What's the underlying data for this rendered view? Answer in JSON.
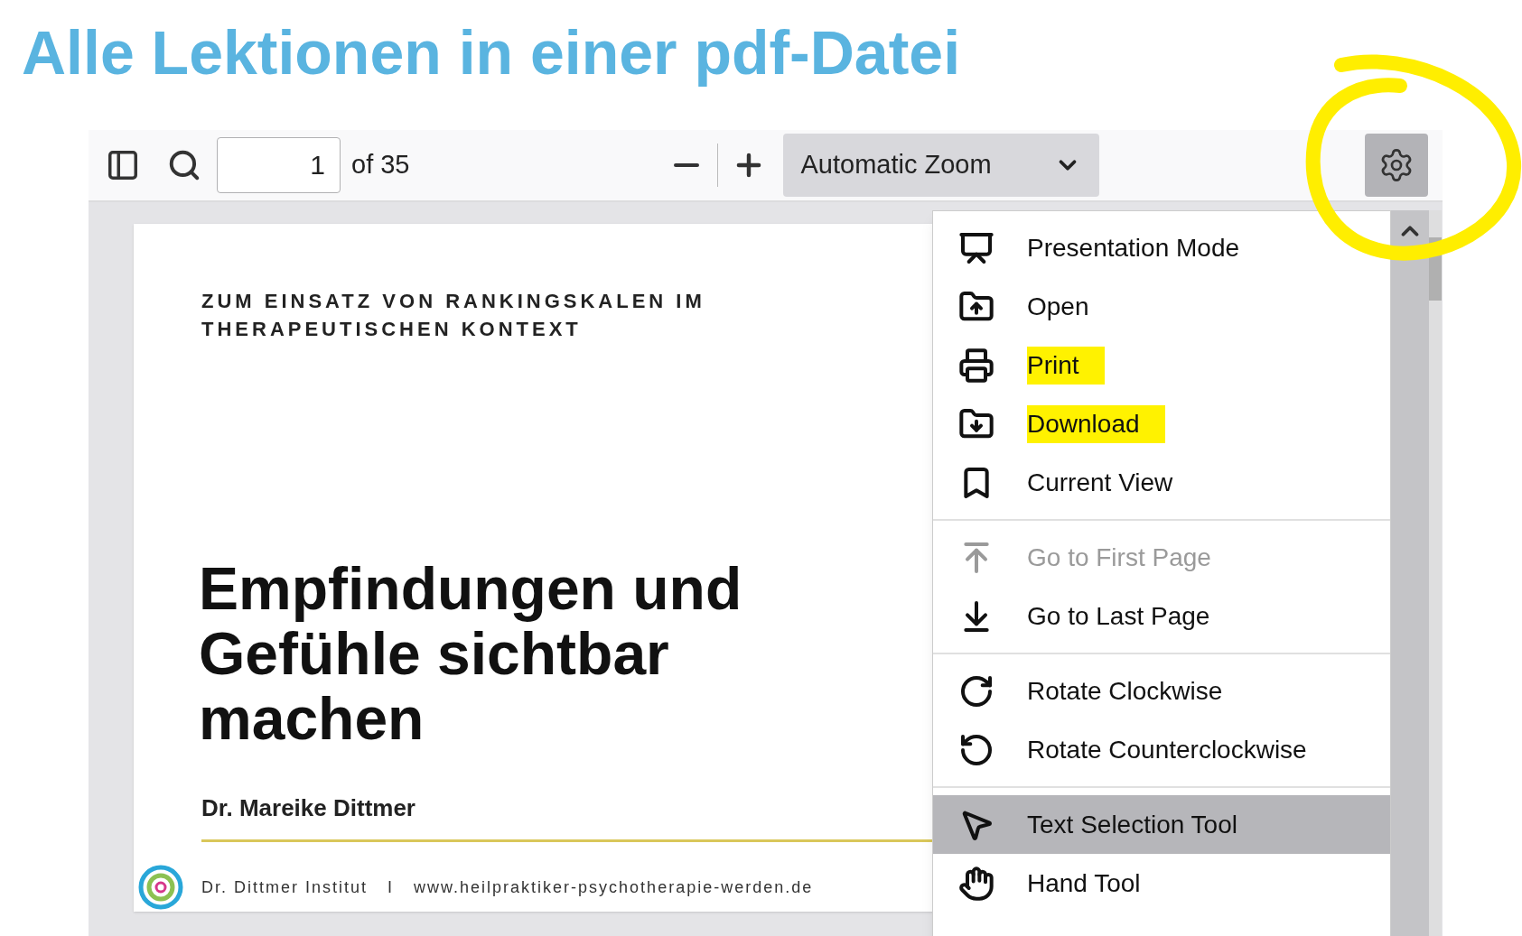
{
  "heading": "Alle Lektionen in einer pdf-Datei",
  "toolbar": {
    "page_number": "1",
    "page_count": "of 35",
    "zoom": "Automatic Zoom",
    "settings_selected": true
  },
  "document": {
    "header": [
      "ZUM EINSATZ VON RANKINGSKALEN IM",
      "THERAPEUTISCHEN KONTEXT"
    ],
    "title": [
      "Empfindungen und",
      "Gefühle sichtbar",
      "machen"
    ],
    "author": "Dr. Mareike Dittmer",
    "footer": {
      "institute": "Dr. Dittmer Institut",
      "separator": "I",
      "url": "www.heilpraktiker-psychotherapie-werden.de"
    }
  },
  "menu": {
    "groups": [
      [
        {
          "label": "Presentation Mode",
          "disabled": false,
          "selected": false,
          "highlighted": false
        },
        {
          "label": "Open",
          "disabled": false,
          "selected": false,
          "highlighted": false
        },
        {
          "label": "Print",
          "disabled": false,
          "selected": false,
          "highlighted": true
        },
        {
          "label": "Download",
          "disabled": false,
          "selected": false,
          "highlighted": true
        },
        {
          "label": "Current View",
          "disabled": false,
          "selected": false,
          "highlighted": false
        }
      ],
      [
        {
          "label": "Go to First Page",
          "disabled": true,
          "selected": false,
          "highlighted": false
        },
        {
          "label": "Go to Last Page",
          "disabled": false,
          "selected": false,
          "highlighted": false
        }
      ],
      [
        {
          "label": "Rotate Clockwise",
          "disabled": false,
          "selected": false,
          "highlighted": false
        },
        {
          "label": "Rotate Counterclockwise",
          "disabled": false,
          "selected": false,
          "highlighted": false
        }
      ],
      [
        {
          "label": "Text Selection Tool",
          "disabled": false,
          "selected": true,
          "highlighted": false
        },
        {
          "label": "Hand Tool",
          "disabled": false,
          "selected": false,
          "highlighted": false
        }
      ]
    ]
  }
}
